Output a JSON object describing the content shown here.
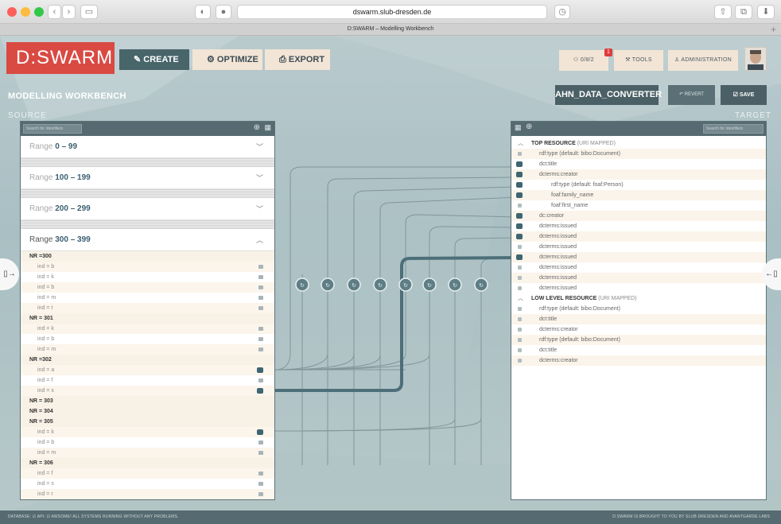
{
  "browser": {
    "url": "dswarm.slub-dresden.de",
    "tab_title": "D:SWARM – Modelling Workbench"
  },
  "header": {
    "logo": "D:SWARM",
    "steps": [
      "CREATE",
      "OPTIMIZE",
      "EXPORT"
    ],
    "tasks_label": "0/8/2",
    "tasks_badge": "1",
    "tools_label": "TOOLS",
    "admin_label": "ADMINISTRATION"
  },
  "workbench": {
    "title": "MODELLING WORKBENCH",
    "source_label": "SOURCE",
    "target_label": "TARGET",
    "converter_name": "AHN_DATA_CONVERTER",
    "revert_label": "REVERT",
    "save_label": "SAVE"
  },
  "source": {
    "search_placeholder": "Search for Identifiers",
    "ranges": [
      {
        "prefix": "Range ",
        "bounds": "0 – 99"
      },
      {
        "prefix": "Range ",
        "bounds": "100 – 199"
      },
      {
        "prefix": "Range ",
        "bounds": "200 – 299"
      },
      {
        "prefix": "Range ",
        "bounds": "300 – 399"
      }
    ],
    "rows": [
      {
        "text": "NR =300",
        "kind": "nr"
      },
      {
        "text": "ind = b",
        "kind": "item",
        "dot": "plain"
      },
      {
        "text": "ind = k",
        "kind": "item",
        "dot": "plain"
      },
      {
        "text": "ind = b",
        "kind": "item",
        "dot": "plain"
      },
      {
        "text": "ind = m",
        "kind": "item",
        "dot": "plain"
      },
      {
        "text": "ind = t",
        "kind": "item",
        "dot": "plain"
      },
      {
        "text": "NR = 301",
        "kind": "nr"
      },
      {
        "text": "ind = k",
        "kind": "item",
        "dot": "plain"
      },
      {
        "text": "ind = b",
        "kind": "item",
        "dot": "plain"
      },
      {
        "text": "ind = m",
        "kind": "item",
        "dot": "plain"
      },
      {
        "text": "NR =302",
        "kind": "nr"
      },
      {
        "text": "ind = a",
        "kind": "item",
        "dot": "conn"
      },
      {
        "text": "ind = f",
        "kind": "item",
        "dot": "plain"
      },
      {
        "text": "ind = x",
        "kind": "item",
        "dot": "conn"
      },
      {
        "text": "NR = 303",
        "kind": "nr"
      },
      {
        "text": "NR = 304",
        "kind": "nr"
      },
      {
        "text": "NR = 305",
        "kind": "nr"
      },
      {
        "text": "ind = k",
        "kind": "item",
        "dot": "conn"
      },
      {
        "text": "ind = b",
        "kind": "item",
        "dot": "plain"
      },
      {
        "text": "ind = m",
        "kind": "item",
        "dot": "plain"
      },
      {
        "text": "NR = 306",
        "kind": "nr"
      },
      {
        "text": "ind = f",
        "kind": "item",
        "dot": "plain"
      },
      {
        "text": "ind = s",
        "kind": "item",
        "dot": "plain"
      },
      {
        "text": "ind = r",
        "kind": "item",
        "dot": "plain"
      }
    ]
  },
  "target": {
    "search_placeholder": "Search for Identifiers",
    "rows": [
      {
        "text": "TOP RESOURCE",
        "note": "(URI MAPPED)",
        "kind": "res"
      },
      {
        "text": "rdf:type (default: bibo:Document)",
        "kind": "item",
        "dot": "plain"
      },
      {
        "text": "dct:title",
        "kind": "item",
        "dot": "conn"
      },
      {
        "text": "dcterms:creator",
        "kind": "item",
        "dot": "conn"
      },
      {
        "text": "rdf:type (default: foaf:Person)",
        "kind": "sub",
        "dot": "conn"
      },
      {
        "text": "foaf:family_name",
        "kind": "sub",
        "dot": "conn"
      },
      {
        "text": "foaf:first_name",
        "kind": "sub",
        "dot": "plain"
      },
      {
        "text": "dc:creator",
        "kind": "item",
        "dot": "conn"
      },
      {
        "text": "dcterms:issued",
        "kind": "item",
        "dot": "conn"
      },
      {
        "text": "dcterms:issued",
        "kind": "item",
        "dot": "conn"
      },
      {
        "text": "dcterms:issued",
        "kind": "item",
        "dot": "plain"
      },
      {
        "text": "dcterms:issued",
        "kind": "item",
        "dot": "conn"
      },
      {
        "text": "dcterms:issued",
        "kind": "item",
        "dot": "plain"
      },
      {
        "text": "dcterms:issued",
        "kind": "item",
        "dot": "plain"
      },
      {
        "text": "dcterms:issued",
        "kind": "item",
        "dot": "plain"
      },
      {
        "text": "LOW LEVEL RESOURCE",
        "note": "(URI MAPPED)",
        "kind": "res"
      },
      {
        "text": "rdf:type (default: bibo:Document)",
        "kind": "item",
        "dot": "plain"
      },
      {
        "text": "dct:title",
        "kind": "item",
        "dot": "plain"
      },
      {
        "text": "dcterms:creator",
        "kind": "item",
        "dot": "plain"
      },
      {
        "text": "rdf:type (default: bibo:Document)",
        "kind": "item",
        "dot": "plain"
      },
      {
        "text": "dct:title",
        "kind": "item",
        "dot": "plain"
      },
      {
        "text": "dcterms:creator",
        "kind": "item",
        "dot": "plain"
      }
    ]
  },
  "footer": {
    "status": "DATABASE: ☑  API: ☑  AWSOME! ALL SYSTEMS RUNNING WITHOUT ANY PROBLEMS.",
    "credit": "D:SWARM IS BROUGHT TO YOU BY SLUB DRESDEN AND AVANTGARDE LABS"
  },
  "colors": {
    "accent": "#d94a43",
    "panel_header": "#566b71",
    "connection": "#3e6570",
    "step_active": "#48656a",
    "step_inactive": "#f2e5d6"
  }
}
